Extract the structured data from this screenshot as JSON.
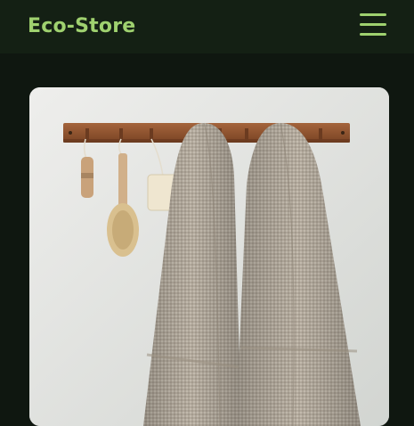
{
  "header": {
    "brand": "Eco-Store",
    "menu_icon": "hamburger-menu-icon"
  },
  "colors": {
    "background": "#0f1710",
    "navbar": "#142014",
    "accent": "#9fd16f"
  },
  "hero": {
    "image_icon": "bathroom-towels-photo"
  }
}
